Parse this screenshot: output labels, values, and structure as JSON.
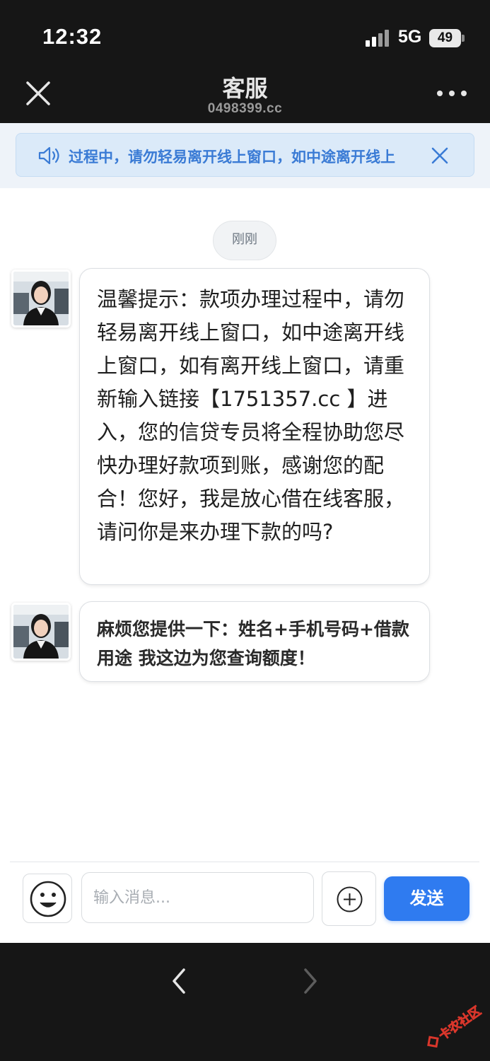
{
  "status_bar": {
    "time": "12:32",
    "network": "5G",
    "battery": "49"
  },
  "nav": {
    "title": "客服",
    "subtitle": "0498399.cc"
  },
  "notice": {
    "text": "过程中，请勿轻易离开线上窗口，如中途离开线上"
  },
  "chat": {
    "timestamp": "刚刚",
    "messages": [
      {
        "sender": "agent",
        "text": "温馨提示：款项办理过程中，请勿轻易离开线上窗口，如中途离开线上窗口，如有离开线上窗口，请重新输入链接【1751357.cc 】进入，您的信贷专员将全程协助您尽快办理好款项到账，感谢您的配合！您好，我是放心借在线客服，请问你是来办理下款的吗?"
      },
      {
        "sender": "agent",
        "text": "麻烦您提供一下：姓名+手机号码+借款用途 我这边为您查询额度！"
      }
    ]
  },
  "composer": {
    "placeholder": "输入消息...",
    "value": "",
    "send_label": "发送"
  },
  "watermark": {
    "text": "卡农社区"
  },
  "colors": {
    "accent": "#2f7bf0",
    "notice_text": "#3a7bd5",
    "notice_bg": "#dbeaf9",
    "chrome": "#161616"
  }
}
